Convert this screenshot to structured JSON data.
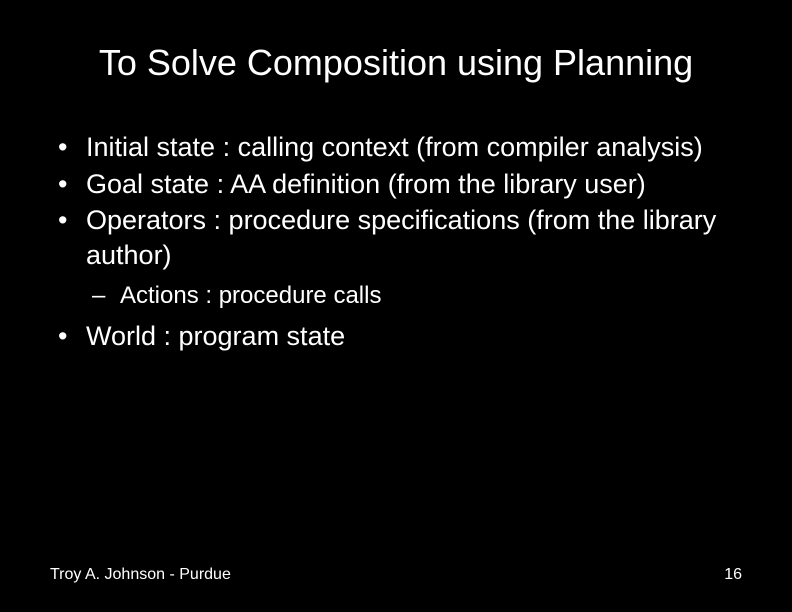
{
  "title": "To Solve Composition using Planning",
  "bullets": [
    {
      "text": "Initial state : calling context (from compiler analysis)"
    },
    {
      "text": "Goal state : AA definition (from the library user)"
    },
    {
      "text": "Operators : procedure specifications (from the library author)",
      "sub": [
        {
          "text": "Actions : procedure calls"
        }
      ]
    },
    {
      "text": "World : program state"
    }
  ],
  "footer": {
    "left": "Troy A. Johnson - Purdue",
    "right": "16"
  }
}
